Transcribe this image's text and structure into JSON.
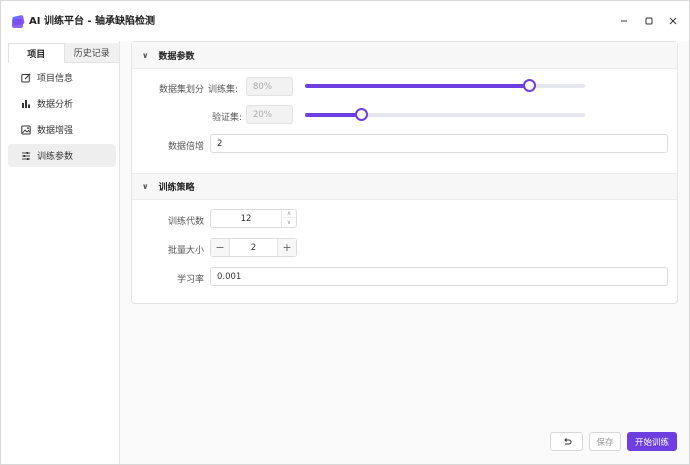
{
  "window": {
    "title": "AI 训练平台 - 轴承缺陷检测",
    "controls": [
      "minimize-icon",
      "maximize-icon",
      "close-icon"
    ]
  },
  "sidebar": {
    "tabs": [
      {
        "label": "项目",
        "active": true
      },
      {
        "label": "历史记录",
        "active": false
      }
    ],
    "items": [
      {
        "label": "项目信息",
        "icon": "edit-icon",
        "active": false
      },
      {
        "label": "数据分析",
        "icon": "bar-chart-icon",
        "active": false
      },
      {
        "label": "数据增强",
        "icon": "image-icon",
        "active": false
      },
      {
        "label": "训练参数",
        "icon": "sliders-icon",
        "active": true
      }
    ]
  },
  "data_params": {
    "title": "数据参数",
    "split_label": "数据集划分",
    "train_label": "训练集:",
    "train_value": "80%",
    "train_fraction": 0.8,
    "val_label": "验证集:",
    "val_value": "20%",
    "val_fraction": 0.2,
    "multiplier_label": "数据倍增",
    "multiplier_value": "2"
  },
  "train_strategy": {
    "title": "训练策略",
    "epochs_label": "训练代数",
    "epochs_value": "12",
    "batch_label": "批量大小",
    "batch_value": "2",
    "lr_label": "学习率",
    "lr_value": "0.001"
  },
  "footer": {
    "undo_icon": "undo-icon",
    "save_label": "保存",
    "start_label": "开始训练"
  },
  "colors": {
    "accent": "#6d3fe0"
  }
}
